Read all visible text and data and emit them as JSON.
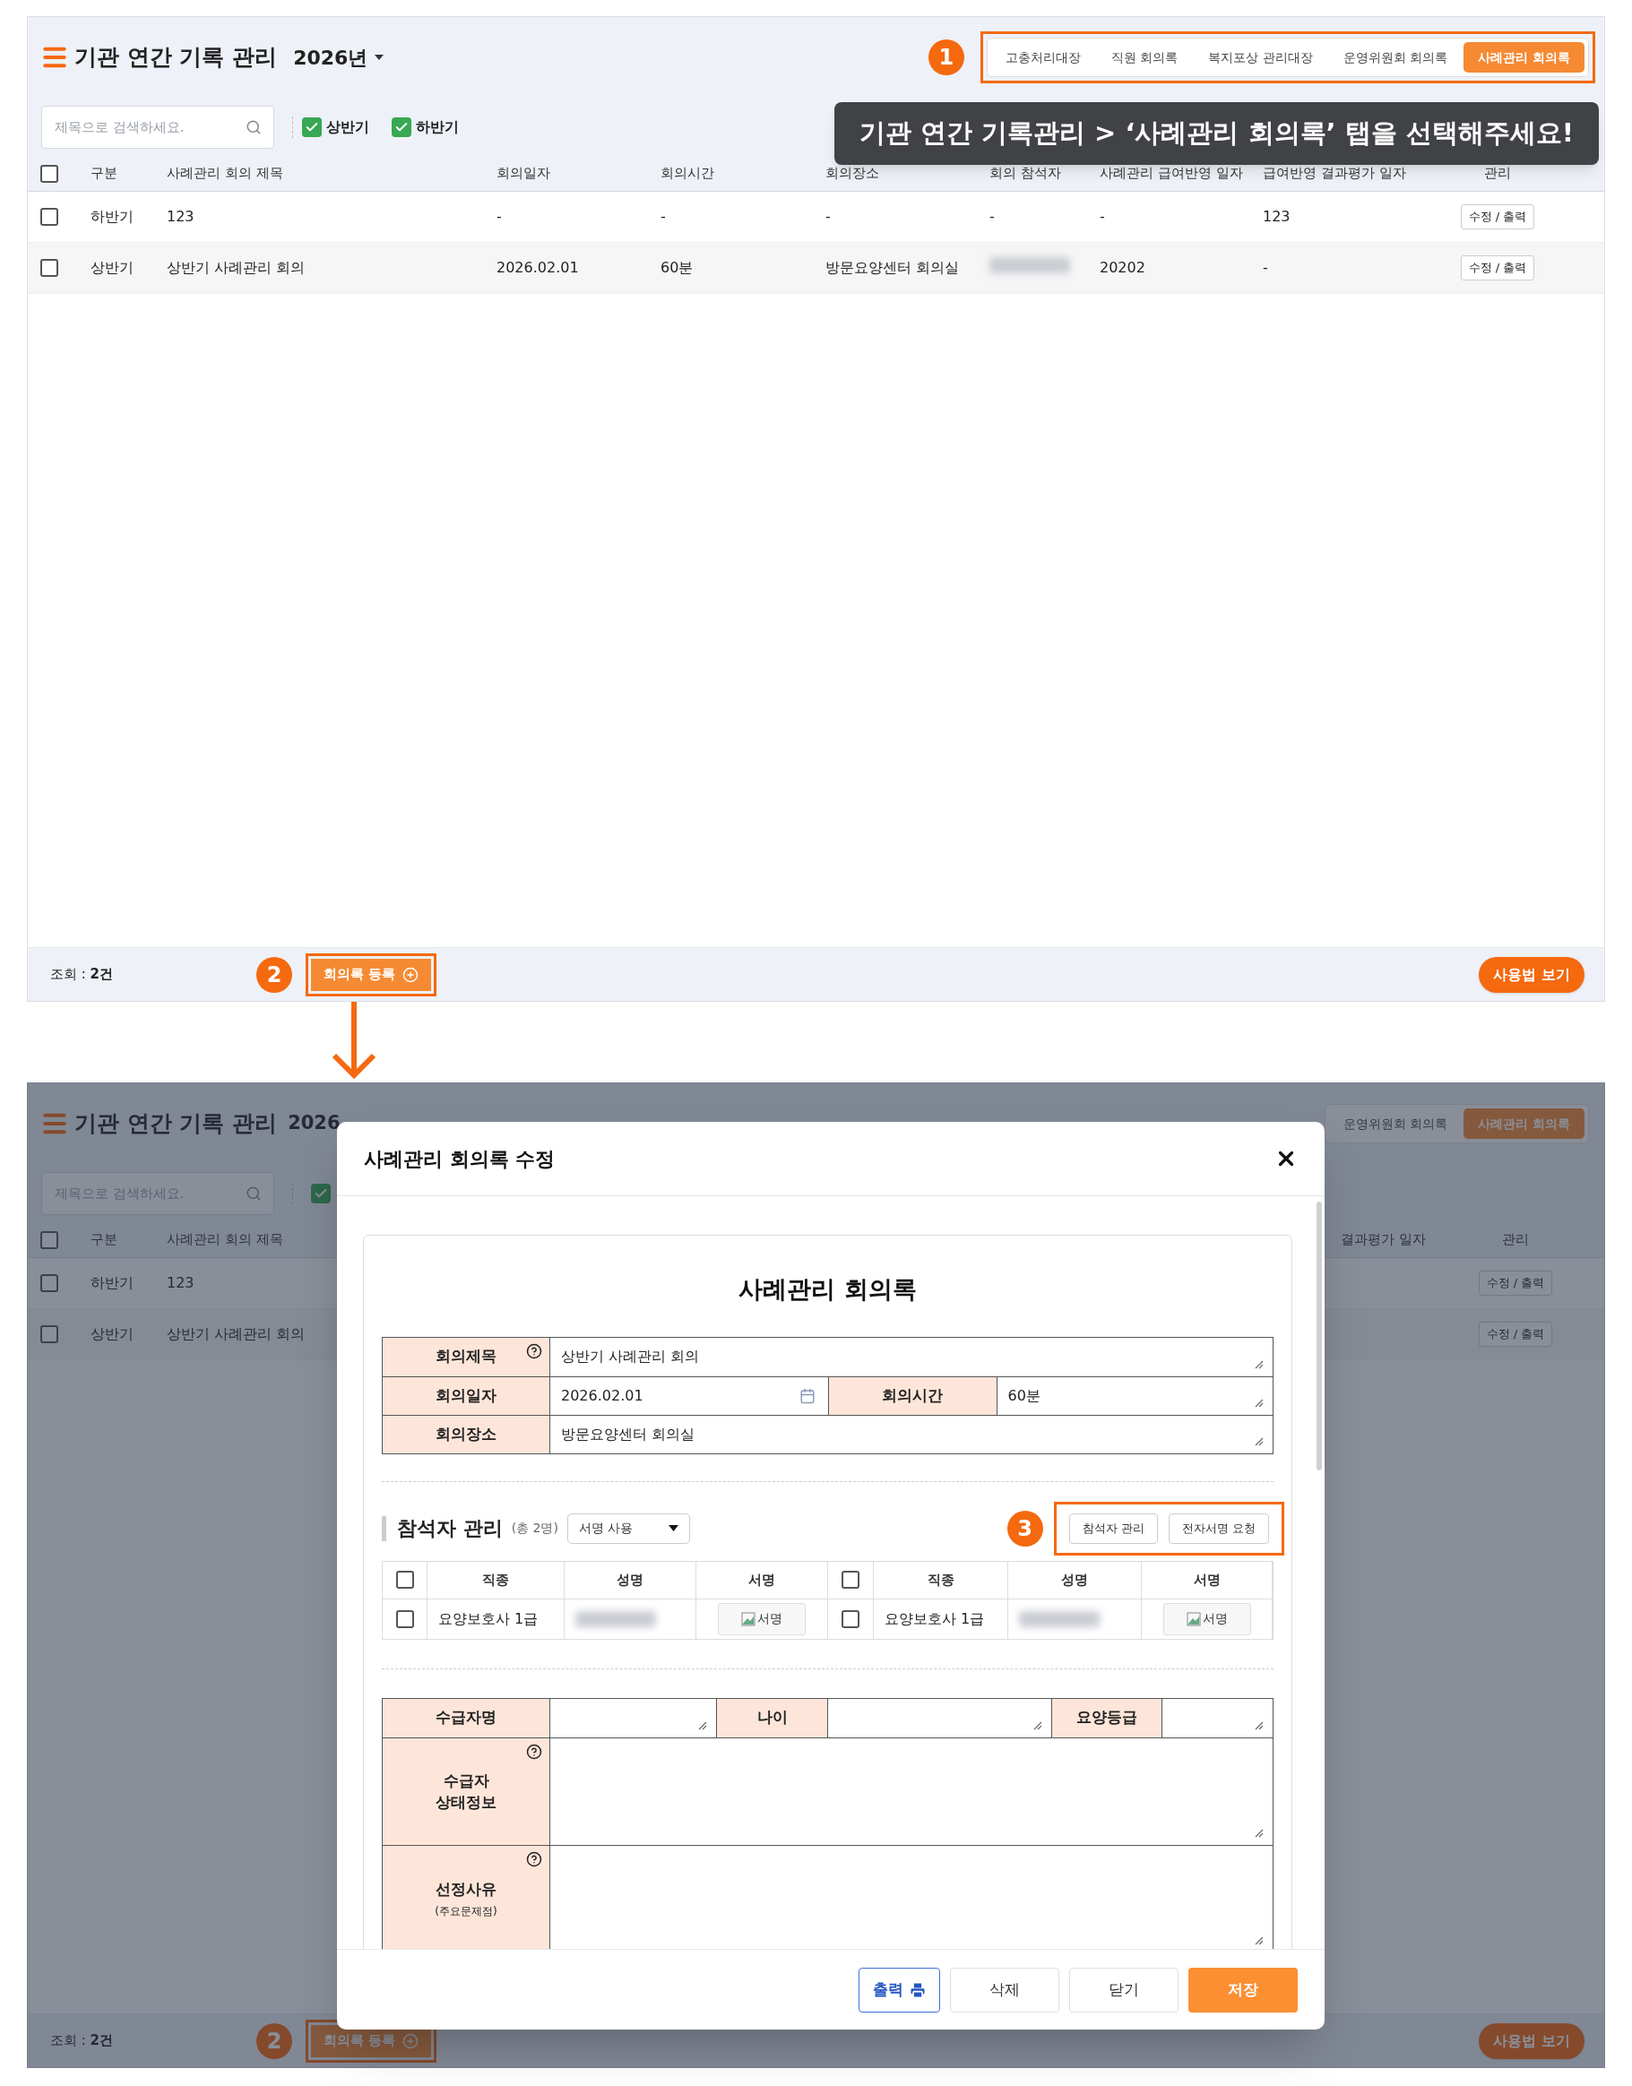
{
  "page": {
    "title": "기관 연간 기록 관리",
    "year": "2026년",
    "tabs": [
      {
        "label": "고충처리대장",
        "selected": false
      },
      {
        "label": "직원 회의록",
        "selected": false
      },
      {
        "label": "복지포상 관리대장",
        "selected": false
      },
      {
        "label": "운영위원회 회의록",
        "selected": false
      },
      {
        "label": "사례관리 회의록",
        "selected": true
      }
    ],
    "search": {
      "placeholder": "제목으로 검색하세요."
    },
    "filters": [
      {
        "label": "상반기",
        "checked": true
      },
      {
        "label": "하반기",
        "checked": true
      }
    ],
    "all_checked": false,
    "columns": [
      "구분",
      "사례관리 회의 제목",
      "회의일자",
      "회의시간",
      "회의장소",
      "회의 참석자",
      "사례관리 급여반영 일자",
      "급여반영 결과평가 일자",
      "관리"
    ],
    "rows": [
      {
        "checked": false,
        "cells": [
          "하반기",
          "123",
          "-",
          "-",
          "-",
          "-",
          "-",
          "123"
        ],
        "action": "수정 / 출력"
      },
      {
        "checked": false,
        "cells": [
          "상반기",
          "상반기 사례관리 회의",
          "2026.02.01",
          "60분",
          "방문요양센터 회의실",
          null,
          "20202",
          "-"
        ],
        "action": "수정 / 출력"
      }
    ],
    "footer": {
      "count": "조회 : **2건**",
      "step": "2",
      "register_button": "회의록 등록",
      "help_button": "사용법 보기"
    },
    "tabs_step": "1"
  },
  "callout": "기관 연간 기록관리 > ‘사례관리 회의록’ 탭을 선택해주세요!",
  "background_page": {
    "title": "기관 연간 기록 관리",
    "year": "2026",
    "tabs": [
      {
        "label": "운영위원회 회의록",
        "selected": false
      },
      {
        "label": "사례관리 회의록",
        "selected": true
      }
    ],
    "search": {
      "placeholder": "제목으로 검색하세요."
    },
    "filters": [
      {
        "checked": true
      }
    ],
    "all_checked": false,
    "columns_left": [
      "구분",
      "사례관리 회의 제목"
    ],
    "columns_right": [
      "결과평가 일자",
      "관리"
    ],
    "rows": [
      {
        "checked": false,
        "cells": [
          "하반기",
          "123"
        ],
        "action": "수정 / 출력"
      },
      {
        "checked": false,
        "cells": [
          "상반기",
          "상반기 사례관리 회의"
        ],
        "action": "수정 / 출력"
      }
    ],
    "footer": {
      "count": "조회 : **2건**",
      "step": "2",
      "register_button": "회의록 등록",
      "help_button": "사용법 보기"
    }
  },
  "modal": {
    "title": "사례관리 회의록 수정",
    "form_title": "사례관리 회의록",
    "meeting_rows": [
      [
        {
          "label": "회의제목",
          "value": "상반기 사례관리 회의",
          "help": true,
          "kind": "text"
        }
      ],
      [
        {
          "label": "회의일자",
          "value": "2026.02.01",
          "help": false,
          "kind": "date"
        },
        {
          "label": "회의시간",
          "value": "60분",
          "help": false,
          "kind": "text"
        }
      ],
      [
        {
          "label": "회의장소",
          "value": "방문요양센터 회의실",
          "help": false,
          "kind": "text"
        }
      ]
    ],
    "participants": {
      "step": "3",
      "title": "참석자 관리",
      "total": "(총 2명)",
      "signature_mode": "서명 사용",
      "buttons": [
        "참석자 관리",
        "전자서명 요청"
      ],
      "header_checked": [
        false,
        false
      ],
      "columns": [
        [
          "직종",
          "성명",
          "서명"
        ],
        [
          "직종",
          "성명",
          "서명"
        ]
      ],
      "entries": [
        {
          "checked": false,
          "job": "요양보호사 1급",
          "sign_button": "서명"
        },
        {
          "checked": false,
          "job": "요양보호사 1급",
          "sign_button": "서명"
        }
      ]
    },
    "recipient_fields": [
      {
        "label": "수급자명"
      },
      {
        "label": "나이"
      },
      {
        "label": "요양등급"
      }
    ],
    "recipient_sections": [
      {
        "label": "수급자 상태정보",
        "help": true
      },
      {
        "label": "선정사유",
        "sublabel": "(주요문제점)",
        "help": true
      }
    ],
    "buttons": [
      {
        "label": "출력",
        "kind": "print"
      },
      {
        "label": "삭제",
        "kind": "plain"
      },
      {
        "label": "닫기",
        "kind": "plain"
      },
      {
        "label": "저장",
        "kind": "primary"
      }
    ]
  }
}
